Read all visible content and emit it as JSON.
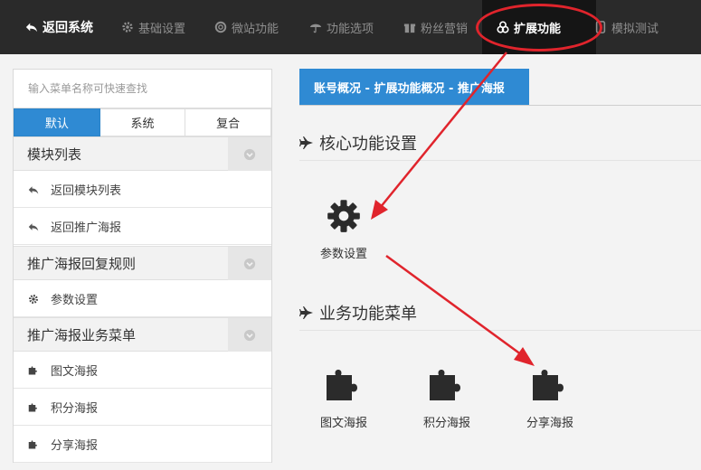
{
  "topnav": {
    "back": "返回系统",
    "items": [
      "基础设置",
      "微站功能",
      "功能选项",
      "粉丝营销",
      "扩展功能",
      "模拟测试"
    ],
    "active_index": 4,
    "highlight_color": "#e0242c"
  },
  "sidebar": {
    "search_placeholder": "输入菜单名称可快速查找",
    "tabs": [
      "默认",
      "系统",
      "复合"
    ],
    "active_tab": 0,
    "groups": [
      {
        "title": "模块列表",
        "items": [
          "返回模块列表",
          "返回推广海报"
        ]
      },
      {
        "title": "推广海报回复规则",
        "items": [
          "参数设置"
        ]
      },
      {
        "title": "推广海报业务菜单",
        "items": [
          "图文海报",
          "积分海报",
          "分享海报"
        ]
      }
    ]
  },
  "main": {
    "breadcrumb": "账号概况 - 扩展功能概况 - 推广海报",
    "core_title": "核心功能设置",
    "core_tiles": [
      "参数设置"
    ],
    "business_title": "业务功能菜单",
    "business_tiles": [
      "图文海报",
      "积分海报",
      "分享海报"
    ]
  },
  "colors": {
    "accent": "#2f8ad3",
    "nav_bg": "#2a2a2a",
    "annotation": "#e0242c"
  }
}
